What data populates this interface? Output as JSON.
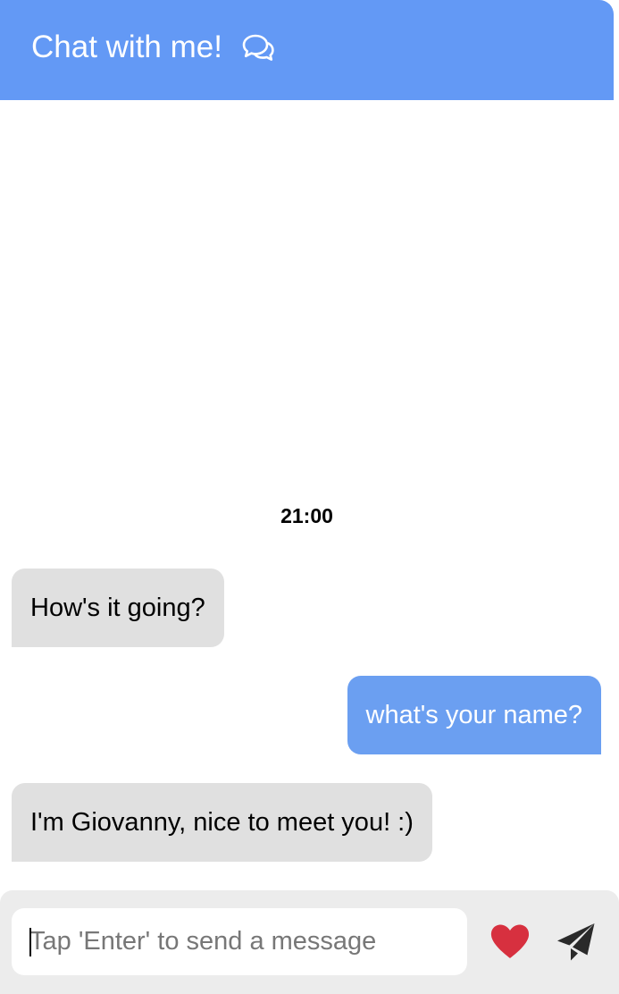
{
  "header": {
    "title": "Chat with me!",
    "icon": "chat-bubbles-icon",
    "background": "#6399f5"
  },
  "chat": {
    "timestamp": "21:00",
    "messages": [
      {
        "sender": "bot",
        "text": "How's it going?"
      },
      {
        "sender": "user",
        "text": "what's your name?"
      },
      {
        "sender": "bot",
        "text": "I'm Giovanny, nice to meet you! :)"
      }
    ],
    "incoming_color": "#e0e0e0",
    "outgoing_color": "#6b9ff1"
  },
  "composer": {
    "placeholder": "Tap 'Enter' to send a message",
    "value": "",
    "like_icon": "heart-icon",
    "like_color": "#d7303f",
    "send_icon": "paper-plane-icon",
    "send_color": "#2a2a2a"
  }
}
